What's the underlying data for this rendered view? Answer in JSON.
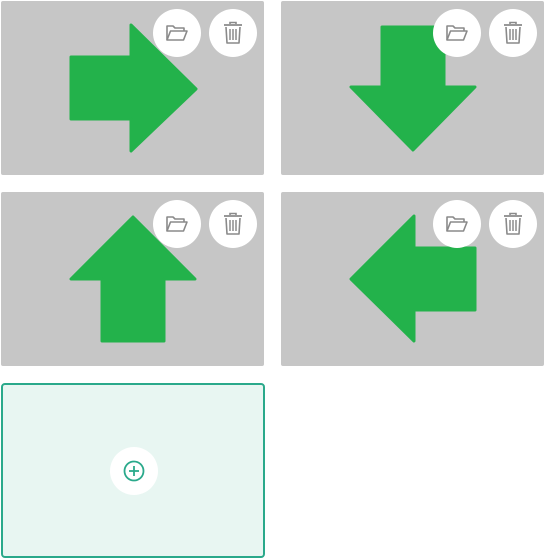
{
  "colors": {
    "card_background": "#c6c6c6",
    "arrow_green": "#23b24b",
    "icon_gray": "#8a8a8a",
    "accent_teal": "#2aa98b",
    "add_card_background": "#e8f6f2"
  },
  "cards": [
    {
      "direction": "right",
      "icons": [
        "folder-open-icon",
        "trash-icon"
      ]
    },
    {
      "direction": "down",
      "icons": [
        "folder-open-icon",
        "trash-icon"
      ]
    },
    {
      "direction": "up",
      "icons": [
        "folder-open-icon",
        "trash-icon"
      ]
    },
    {
      "direction": "left",
      "icons": [
        "folder-open-icon",
        "trash-icon"
      ]
    }
  ],
  "add_card": {
    "icon": "plus-circle-icon"
  }
}
